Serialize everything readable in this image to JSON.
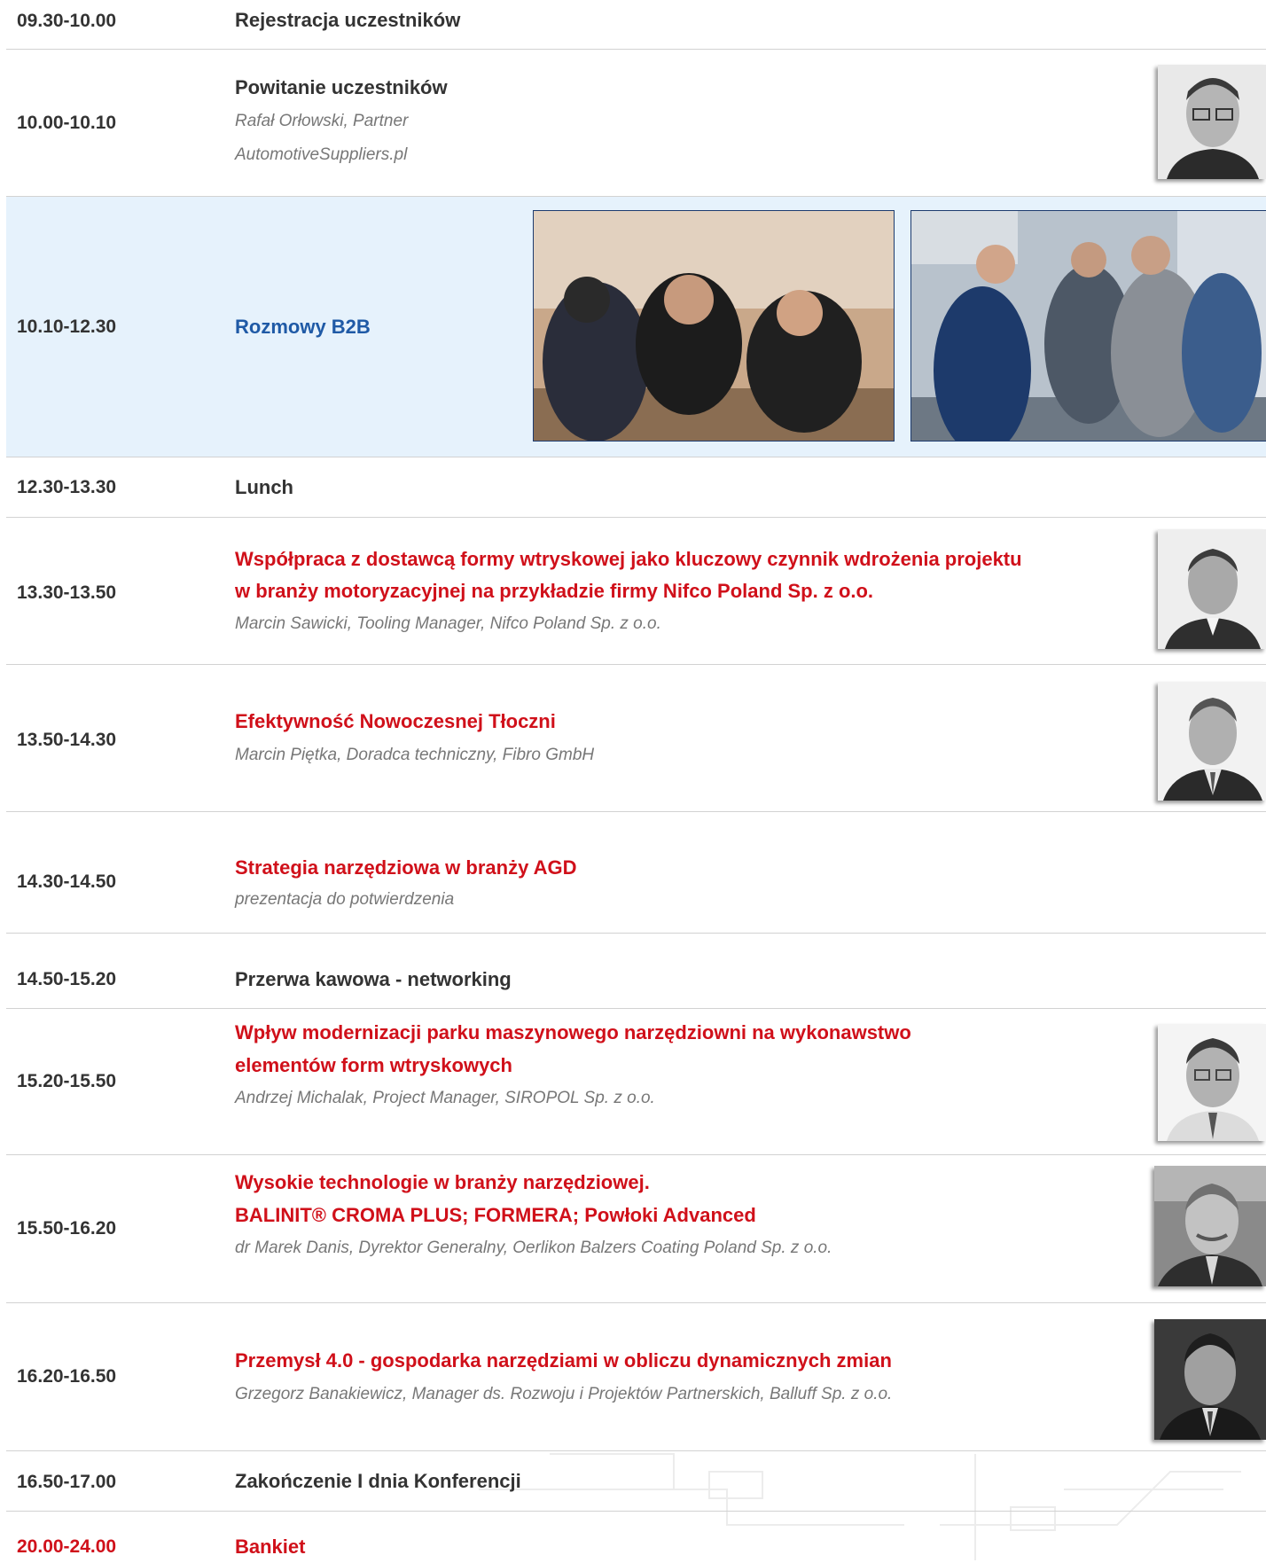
{
  "rows": [
    {
      "time": "09.30-10.00",
      "title": "Rejestracja uczestników"
    },
    {
      "time": "10.00-10.10",
      "title": "Powitanie uczestników",
      "speaker_line1": "Rafał Orłowski, Partner",
      "speaker_line2": "AutomotiveSuppliers.pl"
    },
    {
      "time": "10.10-12.30",
      "title": "Rozmowy B2B"
    },
    {
      "time": "12.30-13.30",
      "title": "Lunch"
    },
    {
      "time": "13.30-13.50",
      "title_line1": "Współpraca z dostawcą formy wtryskowej jako kluczowy czynnik wdrożenia projektu",
      "title_line2": "w branży motoryzacyjnej na przykładzie firmy Nifco Poland Sp. z o.o.",
      "speaker": "Marcin Sawicki, Tooling Manager, Nifco Poland Sp. z o.o."
    },
    {
      "time": "13.50-14.30",
      "title": "Efektywność Nowoczesnej Tłoczni",
      "speaker": "Marcin Piętka, Doradca techniczny, Fibro GmbH"
    },
    {
      "time": "14.30-14.50",
      "title": "Strategia narzędziowa w branży AGD",
      "speaker": "prezentacja do potwierdzenia"
    },
    {
      "time": "14.50-15.20",
      "title": "Przerwa kawowa - networking"
    },
    {
      "time": "15.20-15.50",
      "title_line1": "Wpływ modernizacji parku maszynowego narzędziowni na wykonawstwo",
      "title_line2": "elementów  form wtryskowych",
      "speaker": "Andrzej Michalak, Project Manager, SIROPOL Sp. z o.o."
    },
    {
      "time": "15.50-16.20",
      "title_line1": "Wysokie technologie w branży narzędziowej.",
      "title_line2": "BALINIT® CROMA PLUS; FORMERA; Powłoki Advanced",
      "speaker": "dr Marek Danis, Dyrektor Generalny, Oerlikon Balzers Coating Poland Sp. z o.o."
    },
    {
      "time": "16.20-16.50",
      "title": "Przemysł 4.0 - gospodarka narzędziami w obliczu dynamicznych zmian",
      "speaker": "Grzegorz Banakiewicz, Manager ds. Rozwoju i Projektów Partnerskich, Balluff Sp. z o.o."
    },
    {
      "time": "16.50-17.00",
      "title": "Zakończenie I dnia Konferencji"
    },
    {
      "time": "20.00-24.00",
      "title": "Bankiet"
    }
  ],
  "colors": {
    "text": "#333333",
    "accent_red": "#d0101a",
    "accent_blue": "#1f5aa6",
    "speaker_gray": "#777777",
    "highlight_row": "#e6f2fc",
    "divider": "#d2d2d2"
  }
}
